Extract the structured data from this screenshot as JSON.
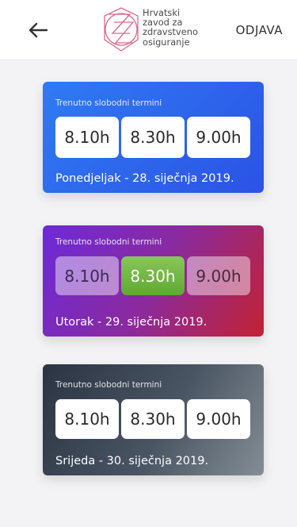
{
  "header": {
    "logo_lines": [
      "Hrvatski",
      "zavod za",
      "zdravstveno",
      "osiguranje"
    ],
    "logout_label": "ODJAVA"
  },
  "cards": [
    {
      "subtitle": "Trenutno slobodni termini",
      "slots": [
        "8.10h",
        "8.30h",
        "9.00h"
      ],
      "date": "Ponedjeljak - 28. siječnja 2019."
    },
    {
      "subtitle": "Trenutno slobodni termini",
      "slots": [
        "8.10h",
        "8.30h",
        "9.00h"
      ],
      "selected_slot": "8.30h",
      "date": "Utorak - 29. siječnja 2019."
    },
    {
      "subtitle": "Trenutno slobodni termini",
      "slots": [
        "8.10h",
        "8.30h",
        "9.00h"
      ],
      "date": "Srijeda - 30. siječnja 2019."
    }
  ],
  "icons": {
    "back": "arrow-left-icon",
    "logo": "hzzo-logo-icon"
  },
  "colors": {
    "card1": "#2c5ce8",
    "card2_start": "#6c2ad9",
    "card2_end": "#c22233",
    "card3": "#3a4452",
    "selected_slot": "#6fb33f"
  }
}
